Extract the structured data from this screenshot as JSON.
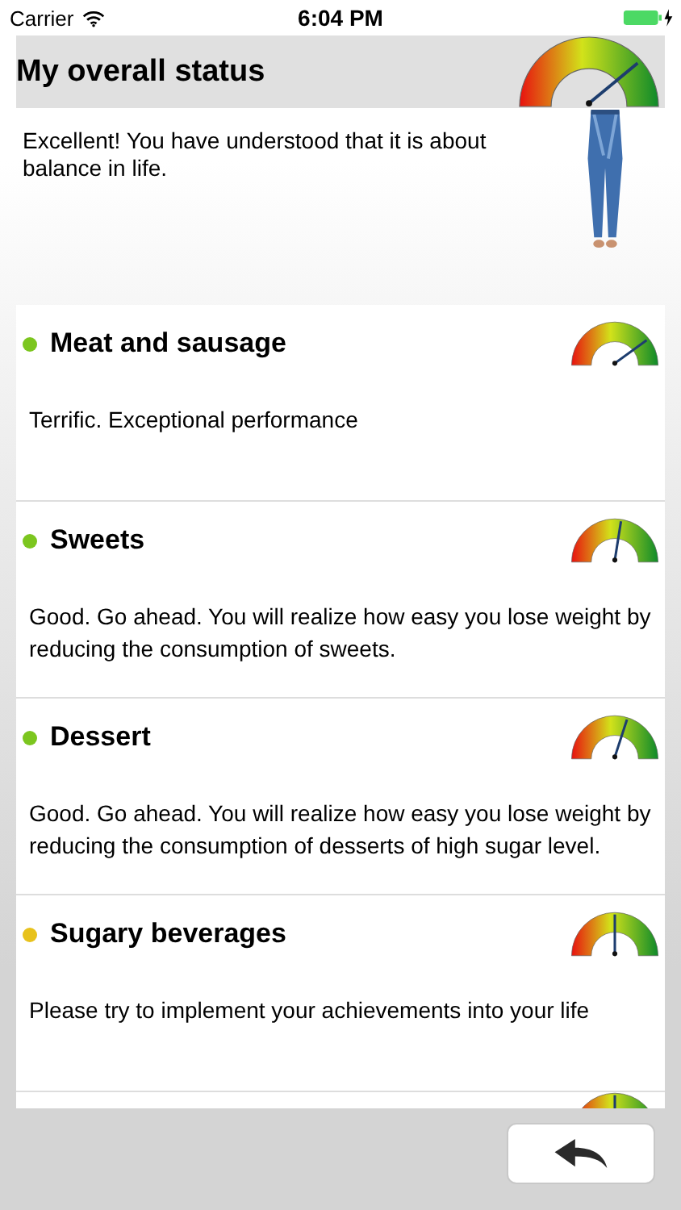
{
  "status_bar": {
    "carrier": "Carrier",
    "time": "6:04 PM"
  },
  "overall": {
    "title": "My overall status",
    "text": "Excellent! You have understood that it is about balance in life."
  },
  "items": [
    {
      "kind": "full",
      "title": "Meat and sausage",
      "color": "#7cc61f",
      "text": "Terrific. Exceptional performance"
    },
    {
      "kind": "full",
      "title": "Sweets",
      "color": "#7cc61f",
      "text": "Good. Go ahead. You will realize how easy you lose weight by reducing the consumption of sweets."
    },
    {
      "kind": "full",
      "title": "Dessert",
      "color": "#7cc61f",
      "text": "Good. Go ahead. You will realize how easy you lose weight by reducing the consumption of desserts of high sugar level."
    },
    {
      "kind": "full",
      "title": "Sugary beverages",
      "color": "#e8c21c",
      "text": "Please try to implement your achievements into your life"
    },
    {
      "kind": "partial"
    }
  ],
  "back_button": {
    "kind": "back"
  }
}
